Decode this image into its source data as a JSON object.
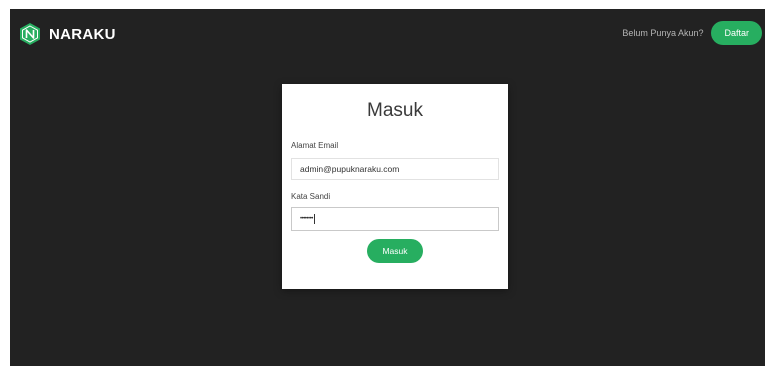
{
  "navbar": {
    "brand_name": "NARAKU",
    "logo_icon": "naraku-hexagon-logo-icon",
    "signup_prompt": "Belum Punya Akun?",
    "signup_button": "Daftar"
  },
  "login_form": {
    "title": "Masuk",
    "email_label": "Alamat Email",
    "email_value": "admin@pupuknaraku.com",
    "password_label": "Kata Sandi",
    "password_value": "••••••••",
    "submit_label": "Masuk"
  },
  "colors": {
    "background": "#222222",
    "accent": "#27ae60",
    "card": "#ffffff"
  }
}
